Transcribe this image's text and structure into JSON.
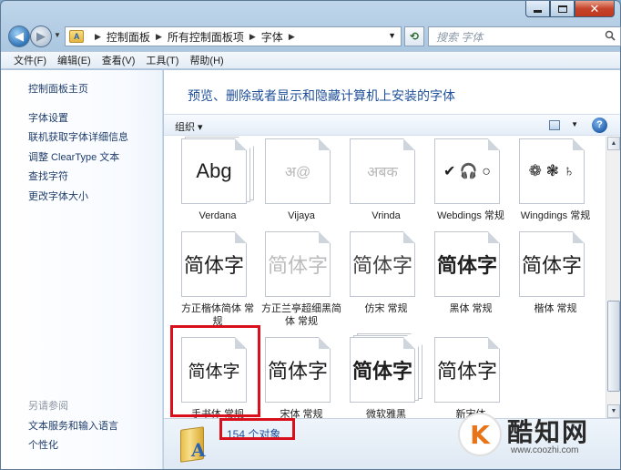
{
  "address": {
    "crumbs": [
      "控制面板",
      "所有控制面板项",
      "字体"
    ],
    "search_placeholder": "搜索 字体"
  },
  "menu": [
    "文件(F)",
    "编辑(E)",
    "查看(V)",
    "工具(T)",
    "帮助(H)"
  ],
  "sidebar": {
    "home": "控制面板主页",
    "links": [
      "字体设置",
      "联机获取字体详细信息",
      "调整 ClearType 文本",
      "查找字符",
      "更改字体大小"
    ],
    "see_also_title": "另请参阅",
    "see_also": [
      "文本服务和输入语言",
      "个性化"
    ]
  },
  "content": {
    "headline": "预览、删除或者显示和隐藏计算机上安装的字体",
    "organize": "组织 ▾",
    "help": "?"
  },
  "fonts": [
    {
      "sample": "Abg",
      "label": "Verdana",
      "stacked": true
    },
    {
      "sample": "अ@",
      "label": "Vijaya",
      "stacked": false
    },
    {
      "sample": "अबक",
      "label": "Vrinda",
      "stacked": false
    },
    {
      "sample": "✔ 🎧 ○",
      "label": "Webdings 常规",
      "stacked": false
    },
    {
      "sample": "❁ ❃ ♄",
      "label": "Wingdings 常规",
      "stacked": false
    },
    {
      "sample": "简体字",
      "label": "方正楷体简体 常规",
      "stacked": false
    },
    {
      "sample": "简体字",
      "label": "方正兰亭超细黑简体 常规",
      "stacked": false
    },
    {
      "sample": "简体字",
      "label": "仿宋 常规",
      "stacked": false
    },
    {
      "sample": "简体字",
      "label": "黑体 常规",
      "stacked": false
    },
    {
      "sample": "简体字",
      "label": "楷体 常规",
      "stacked": false
    },
    {
      "sample": "简体字",
      "label": "手书体 常规",
      "stacked": false
    },
    {
      "sample": "简体字",
      "label": "宋体 常规",
      "stacked": false
    },
    {
      "sample": "简体字",
      "label": "微软雅黑",
      "stacked": true
    },
    {
      "sample": "简体字",
      "label": "新宋体",
      "stacked": false
    }
  ],
  "details": {
    "count": "154 个对象"
  },
  "watermark": {
    "name": "酷知网",
    "url": "www.coozhi.com"
  }
}
